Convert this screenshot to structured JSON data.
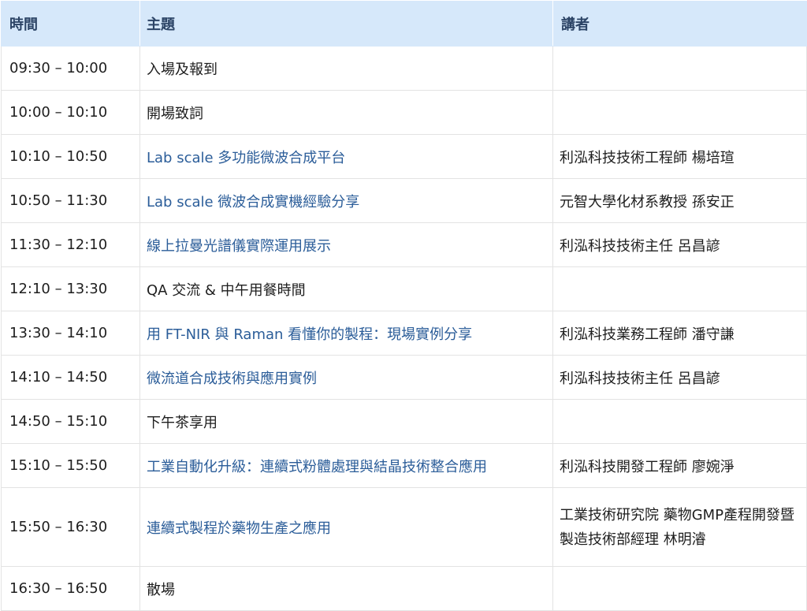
{
  "headers": {
    "time": "時間",
    "topic": "主題",
    "speaker": "講者"
  },
  "rows": [
    {
      "time": "09:30 – 10:00",
      "topic": "入場及報到",
      "speaker": "",
      "link": false
    },
    {
      "time": "10:00 – 10:10",
      "topic": "開場致詞",
      "speaker": "",
      "link": false
    },
    {
      "time": "10:10 – 10:50",
      "topic": "Lab scale 多功能微波合成平台",
      "speaker": "利泓科技技術工程師 楊培瑄",
      "link": true
    },
    {
      "time": "10:50 – 11:30",
      "topic": "Lab scale 微波合成實機經驗分享",
      "speaker": "元智大學化材系教授 孫安正",
      "link": true
    },
    {
      "time": "11:30 – 12:10",
      "topic": "線上拉曼光譜儀實際運用展示",
      "speaker": "利泓科技技術主任 呂昌諺",
      "link": true
    },
    {
      "time": "12:10 – 13:30",
      "topic": "QA 交流 & 中午用餐時間",
      "speaker": "",
      "link": false
    },
    {
      "time": "13:30 – 14:10",
      "topic": "用 FT-NIR 與 Raman 看懂你的製程：現場實例分享",
      "speaker": "利泓科技業務工程師 潘守謙",
      "link": true
    },
    {
      "time": "14:10 – 14:50",
      "topic": "微流道合成技術與應用實例",
      "speaker": "利泓科技技術主任 呂昌諺",
      "link": true
    },
    {
      "time": "14:50 – 15:10",
      "topic": "下午茶享用",
      "speaker": "",
      "link": false
    },
    {
      "time": "15:10 – 15:50",
      "topic": "工業自動化升級：連續式粉體處理與結晶技術整合應用",
      "speaker": "利泓科技開發工程師 廖婉淨",
      "link": true
    },
    {
      "time": "15:50 – 16:30",
      "topic": "連續式製程於藥物生產之應用",
      "speaker": "工業技術研究院 藥物GMP產程開發暨製造技術部經理 林明濬",
      "link": true
    },
    {
      "time": "16:30 – 16:50",
      "topic": "散場",
      "speaker": "",
      "link": false
    }
  ],
  "colors": {
    "header_bg": "#d6e8fa",
    "header_text": "#2c4466",
    "link_text": "#2b5d99",
    "body_text": "#1e1e1e",
    "grid": "#e3e3e3"
  }
}
